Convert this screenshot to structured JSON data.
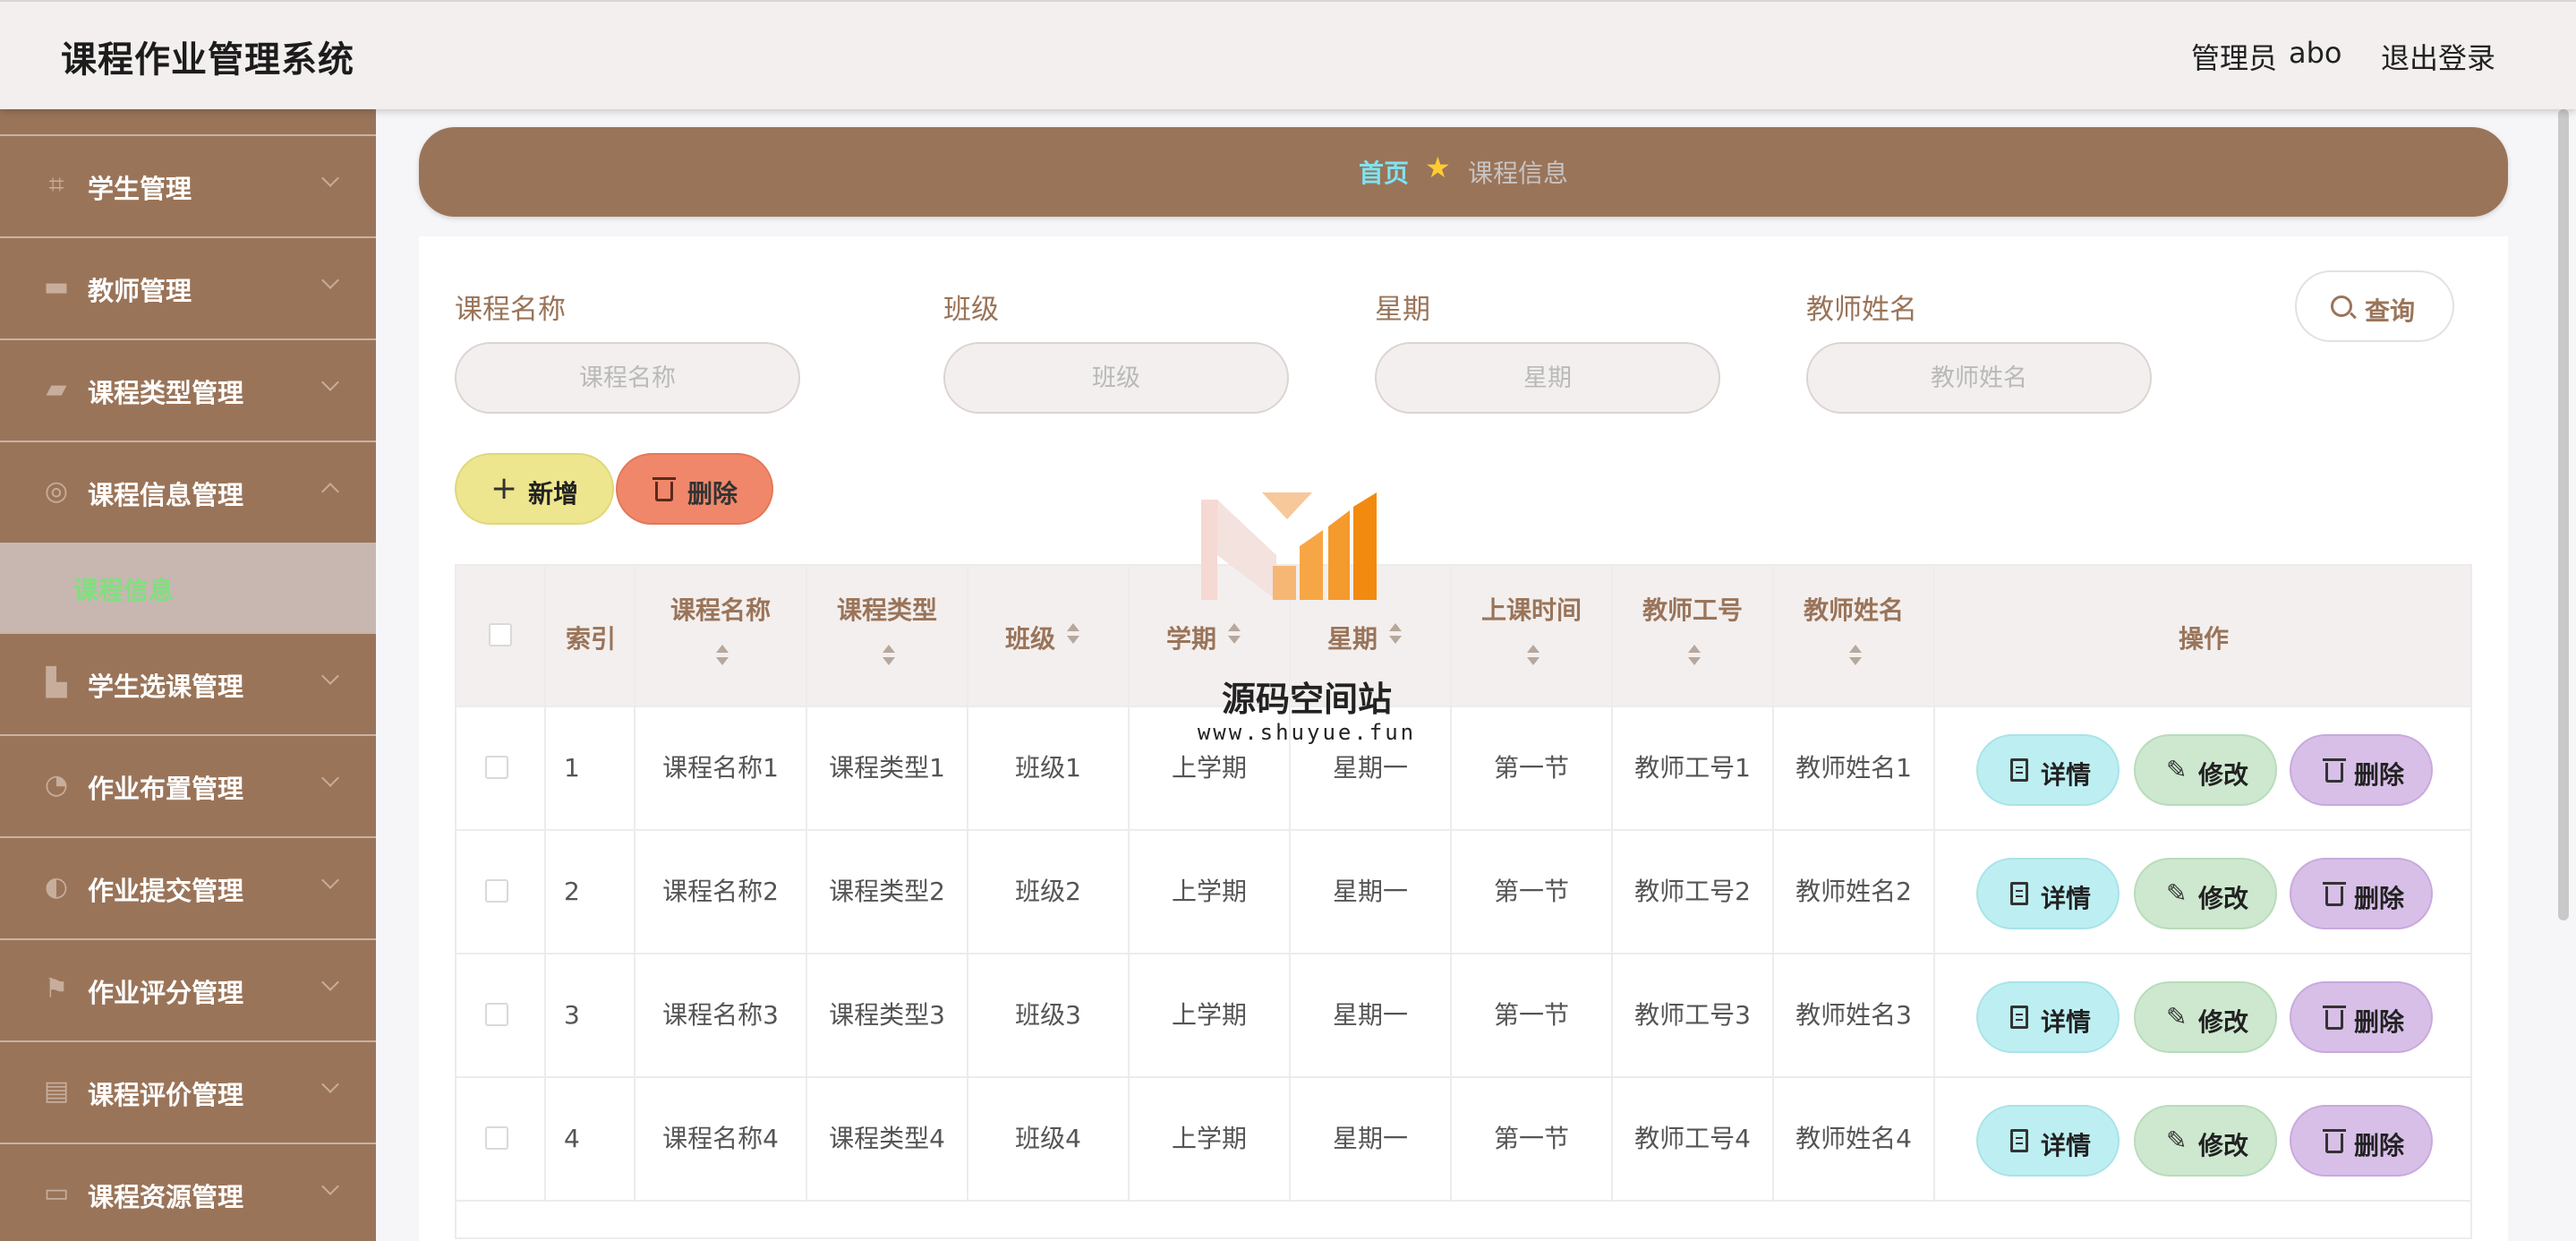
{
  "header": {
    "title": "课程作业管理系统",
    "admin_label": "管理员",
    "admin_name": "abo",
    "logout": "退出登录"
  },
  "sidebar": {
    "items": [
      {
        "label": "学生管理",
        "icon": "crop-icon"
      },
      {
        "label": "教师管理",
        "icon": "briefcase-icon"
      },
      {
        "label": "课程类型管理",
        "icon": "chat-icon"
      },
      {
        "label": "课程信息管理",
        "icon": "target-icon"
      },
      {
        "label": "学生选课管理",
        "icon": "chart-icon"
      },
      {
        "label": "作业布置管理",
        "icon": "gauge-icon"
      },
      {
        "label": "作业提交管理",
        "icon": "compass-icon"
      },
      {
        "label": "作业评分管理",
        "icon": "flag-icon"
      },
      {
        "label": "课程评价管理",
        "icon": "clipboard-icon"
      },
      {
        "label": "课程资源管理",
        "icon": "monitor-icon"
      }
    ],
    "submenu": {
      "label": "课程信息"
    }
  },
  "breadcrumb": {
    "home": "首页",
    "current": "课程信息"
  },
  "search": {
    "fields": [
      {
        "label": "课程名称",
        "placeholder": "课程名称"
      },
      {
        "label": "班级",
        "placeholder": "班级"
      },
      {
        "label": "星期",
        "placeholder": "星期"
      },
      {
        "label": "教师姓名",
        "placeholder": "教师姓名"
      }
    ],
    "query_label": "查询"
  },
  "toolbar": {
    "add_label": "新增",
    "delete_label": "删除"
  },
  "table": {
    "columns": [
      "索引",
      "课程名称",
      "课程类型",
      "班级",
      "学期",
      "星期",
      "上课时间",
      "教师工号",
      "教师姓名",
      "操作"
    ],
    "rows": [
      [
        "1",
        "课程名称1",
        "课程类型1",
        "班级1",
        "上学期",
        "星期一",
        "第一节",
        "教师工号1",
        "教师姓名1"
      ],
      [
        "2",
        "课程名称2",
        "课程类型2",
        "班级2",
        "上学期",
        "星期一",
        "第一节",
        "教师工号2",
        "教师姓名2"
      ],
      [
        "3",
        "课程名称3",
        "课程类型3",
        "班级3",
        "上学期",
        "星期一",
        "第一节",
        "教师工号3",
        "教师姓名3"
      ],
      [
        "4",
        "课程名称4",
        "课程类型4",
        "班级4",
        "上学期",
        "星期一",
        "第一节",
        "教师工号4",
        "教师姓名4"
      ]
    ],
    "actions": {
      "detail": "详情",
      "edit": "修改",
      "delete": "删除"
    }
  },
  "watermark": {
    "text": "源码空间站",
    "url": "www.shuyue.fun"
  },
  "colors": {
    "brand": "#9a7459",
    "header_bg": "#f3efee",
    "breadcrumb_home": "#7fe3f1",
    "submenu_active": "#7ee07e",
    "add_button": "#ede68e",
    "delete_button": "#f0876a",
    "detail_button": "#bdeff2",
    "edit_button": "#cde8cf",
    "row_delete_button": "#d8bfe8"
  }
}
